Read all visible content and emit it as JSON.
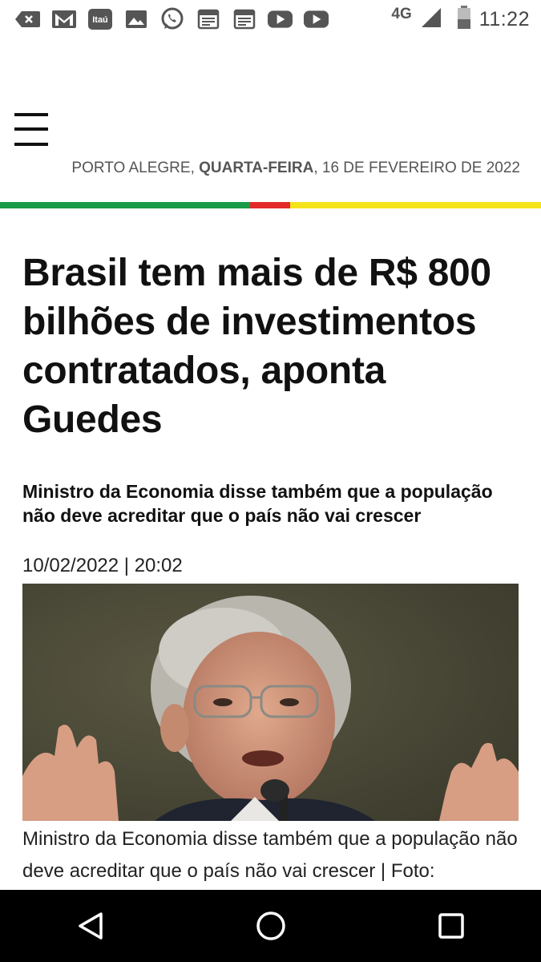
{
  "status_bar": {
    "left_icons": [
      "back-arrow-icon",
      "gmail-icon",
      "itau-icon",
      "image-icon",
      "whatsapp-icon",
      "news-icon",
      "news-icon",
      "youtube-icon",
      "youtube-icon"
    ],
    "itau_label": "Itaú",
    "network": "4G",
    "time": "11:22"
  },
  "header": {
    "city": "PORTO ALEGRE,",
    "weekday": "QUARTA-FEIRA",
    "date": ", 16 DE FEVEREIRO DE 2022",
    "stripe_colors": [
      "#1a9b48",
      "#e42a2a",
      "#f5e31c"
    ]
  },
  "article": {
    "headline": "Brasil tem mais de R$ 800 bilhões de investimentos contratados, aponta Guedes",
    "subtitle": "Ministro da Economia disse também que a população não deve acreditar que o país não vai crescer",
    "timestamp": "10/02/2022 | 20:02",
    "caption": "Ministro da Economia disse também que a população não deve acreditar que o país não vai crescer | Foto:"
  },
  "nav": {
    "buttons": [
      "back-icon",
      "home-icon",
      "recents-icon"
    ]
  }
}
